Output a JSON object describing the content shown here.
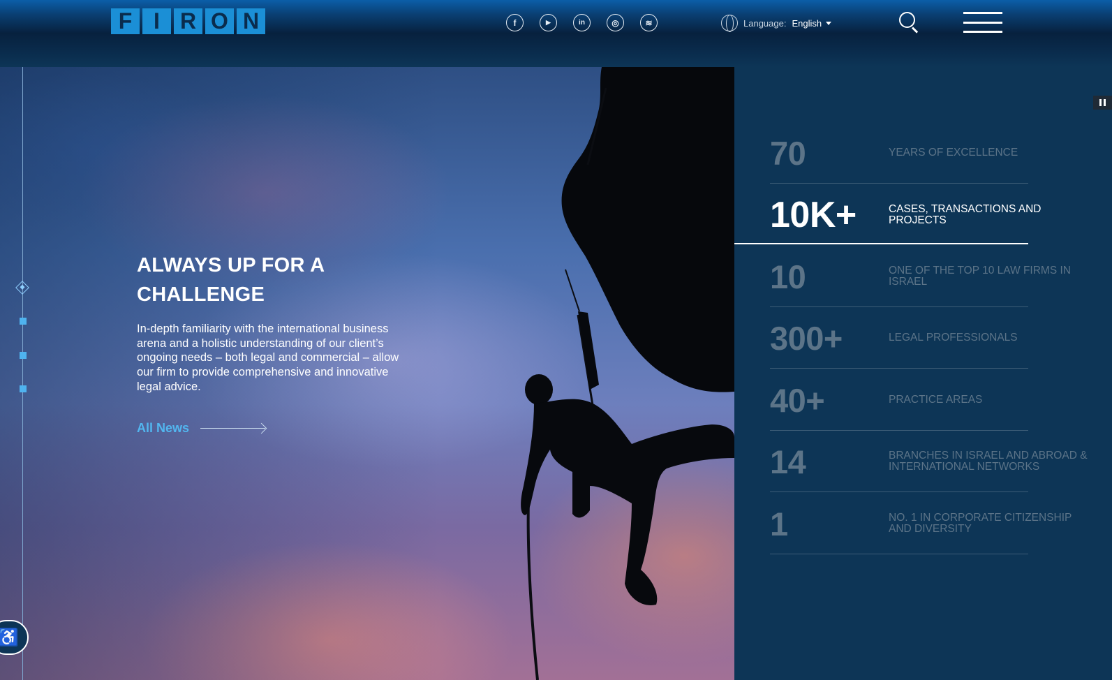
{
  "header": {
    "logo_letters": [
      "F",
      "I",
      "R",
      "O",
      "N"
    ],
    "social_icons": [
      "facebook-icon",
      "youtube-icon",
      "linkedin-icon",
      "instagram-icon",
      "spotify-icon"
    ],
    "social_glyphs": [
      "f",
      "▶",
      "in",
      "◎",
      "≋"
    ],
    "language_label": "Language:",
    "language_value": "English"
  },
  "hero": {
    "title": "ALWAYS UP FOR A CHALLENGE",
    "description": "In-depth familiarity with the international business arena and a holistic understanding of our client’s ongoing needs – both legal and commercial – allow our firm to provide comprehensive and innovative legal advice.",
    "link_label": "All News",
    "accessibility_glyph": "♿"
  },
  "stats": [
    {
      "number": "70",
      "label": "YEARS OF EXCELLENCE"
    },
    {
      "number": "10K+",
      "label": "CASES, TRANSACTIONS AND PROJECTS",
      "active": true
    },
    {
      "number": "10",
      "label": "ONE OF THE TOP 10 LAW FIRMS IN ISRAEL"
    },
    {
      "number": "300+",
      "label": "LEGAL PROFESSIONALS"
    },
    {
      "number": "40+",
      "label": "PRACTICE AREAS"
    },
    {
      "number": "14",
      "label": "BRANCHES IN ISRAEL AND ABROAD & INTERNATIONAL NETWORKS"
    },
    {
      "number": "1",
      "label": "NO. 1 IN CORPORATE CITIZENSHIP AND DIVERSITY"
    }
  ],
  "colors": {
    "accent": "#52b6ef",
    "logo": "#1b8fd6",
    "panel": "#0d3556"
  }
}
